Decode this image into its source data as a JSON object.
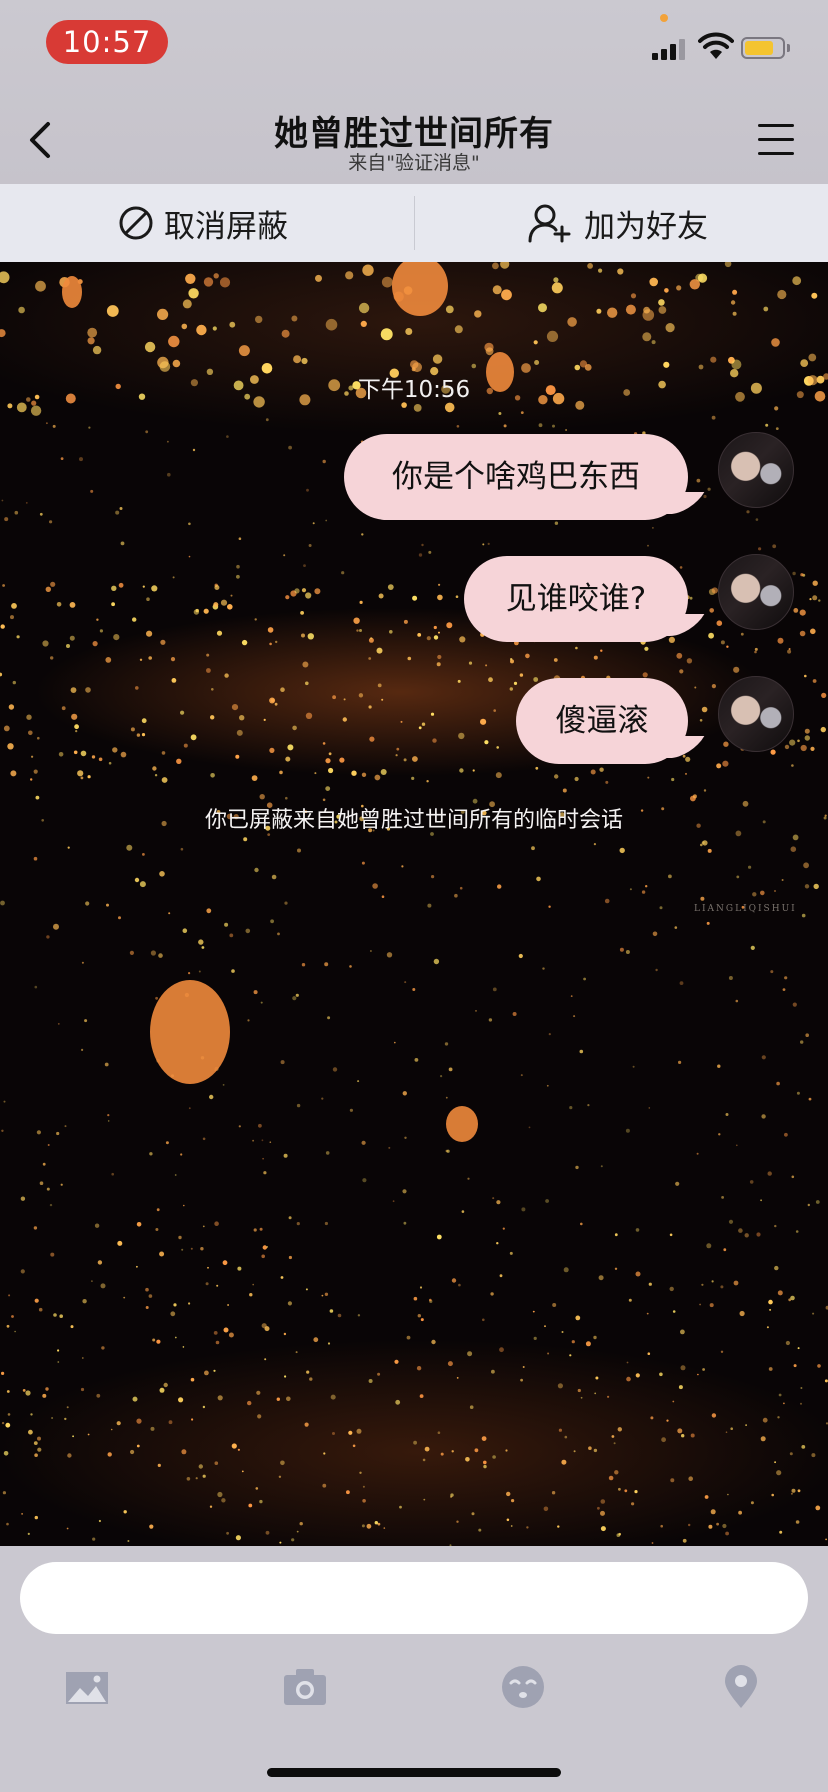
{
  "status_bar": {
    "time": "10:57"
  },
  "header": {
    "title": "她曾胜过世间所有",
    "subtitle": "来自\"验证消息\"",
    "back_icon": "chevron-left-icon",
    "menu_icon": "hamburger-menu-icon"
  },
  "actions": {
    "unblock_label": "取消屏蔽",
    "add_friend_label": "加为好友"
  },
  "chat": {
    "timestamp": "下午10:56",
    "messages": [
      {
        "text": "你是个啥鸡巴东西",
        "sender": "me"
      },
      {
        "text": "见谁咬谁?",
        "sender": "me"
      },
      {
        "text": "傻逼滚",
        "sender": "me"
      }
    ],
    "notice": "你已屏蔽来自她曾胜过世间所有的临时会话",
    "watermark": "LIANGLIQISHUI"
  },
  "input": {
    "placeholder": ""
  },
  "toolbar": [
    "image-icon",
    "camera-icon",
    "emoji-icon",
    "location-icon"
  ],
  "colors": {
    "time_pill": "#d83a35",
    "bubble": "#f6d4d8",
    "top_bar": "#cbc9d0",
    "action_bar": "#e7e8ef"
  }
}
